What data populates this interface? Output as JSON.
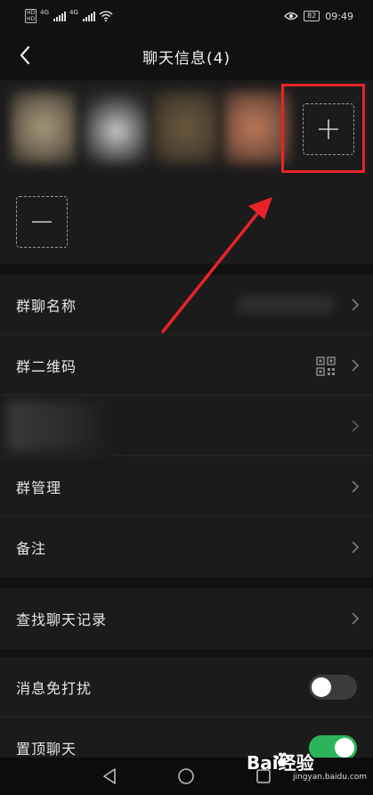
{
  "status_bar": {
    "hd_top": "HD",
    "hd_bottom": "HD",
    "net_1": "4G",
    "net_2": "4G",
    "battery": "82",
    "time": "09:49"
  },
  "nav": {
    "title": "聊天信息(4)"
  },
  "menu_group_1": {
    "items": [
      {
        "label": "群聊名称"
      },
      {
        "label": "群二维码"
      },
      {
        "label": ""
      },
      {
        "label": "群管理"
      },
      {
        "label": "备注"
      }
    ]
  },
  "menu_group_2": {
    "items": [
      {
        "label": "查找聊天记录"
      }
    ]
  },
  "menu_group_3": {
    "items": [
      {
        "label": "消息免打扰",
        "toggle": false
      },
      {
        "label": "置顶聊天",
        "toggle": true
      }
    ]
  },
  "colors": {
    "accent_red": "#e8232b",
    "toggle_on": "#2db45a",
    "background": "#111111",
    "panel": "#1b1b1b"
  },
  "icons": [
    "back-arrow-icon",
    "plus-icon",
    "minus-icon",
    "chevron-right-icon",
    "qr-code-icon",
    "wifi-icon",
    "eye-icon",
    "nav-back-icon",
    "nav-home-icon",
    "nav-recent-icon"
  ],
  "watermark": {
    "brand": "Bai经验",
    "url": "jingyan.baidu.com"
  }
}
